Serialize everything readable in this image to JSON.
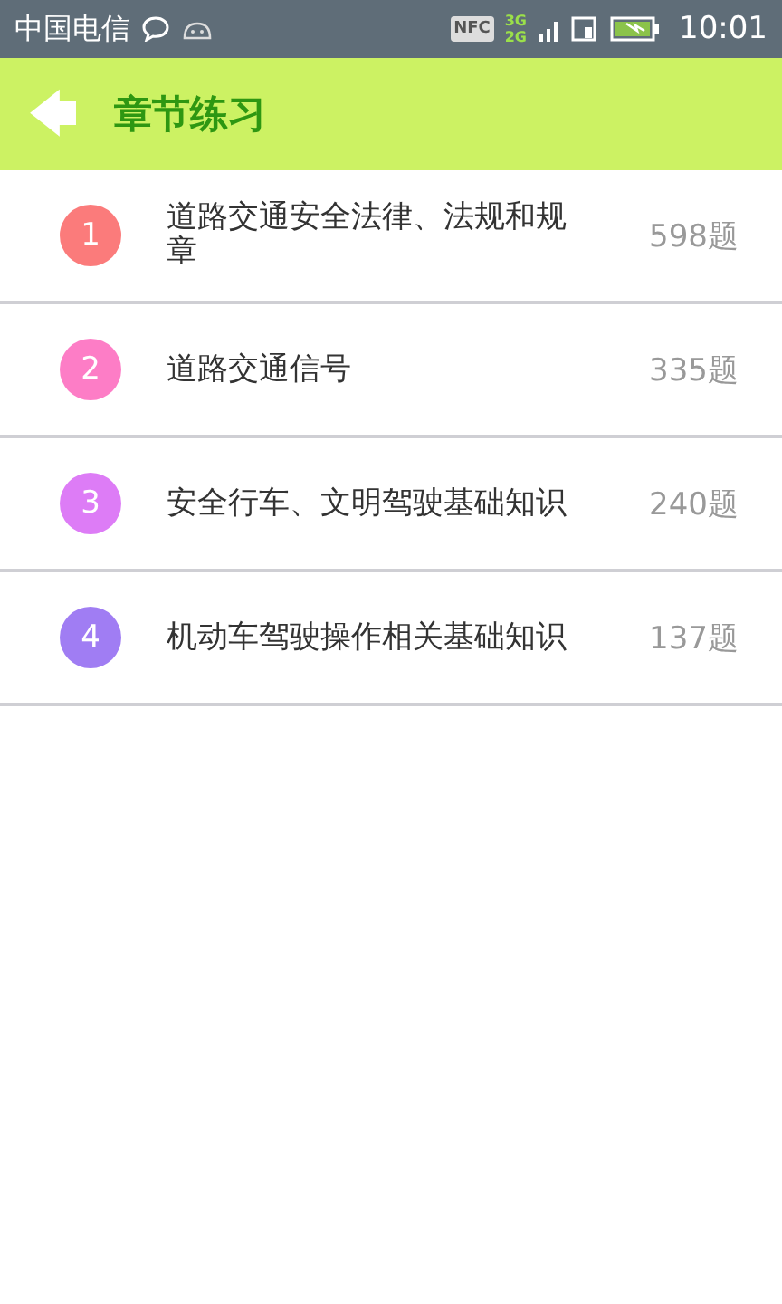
{
  "status_bar": {
    "carrier": "中国电信",
    "nfc": "NFC",
    "network_top": "3G",
    "network_bottom": "2G",
    "time": "10:01"
  },
  "header": {
    "back": "🡄",
    "title": "章节练习"
  },
  "chapters": [
    {
      "number": "1",
      "title": "道路交通安全法律、法规和规章",
      "count": "598题",
      "color": "#fb7b7b"
    },
    {
      "number": "2",
      "title": "道路交通信号",
      "count": "335题",
      "color": "#fd7dc6"
    },
    {
      "number": "3",
      "title": "安全行车、文明驾驶基础知识",
      "count": "240题",
      "color": "#dd7cf6"
    },
    {
      "number": "4",
      "title": "机动车驾驶操作相关基础知识",
      "count": "137题",
      "color": "#a07df3"
    }
  ]
}
